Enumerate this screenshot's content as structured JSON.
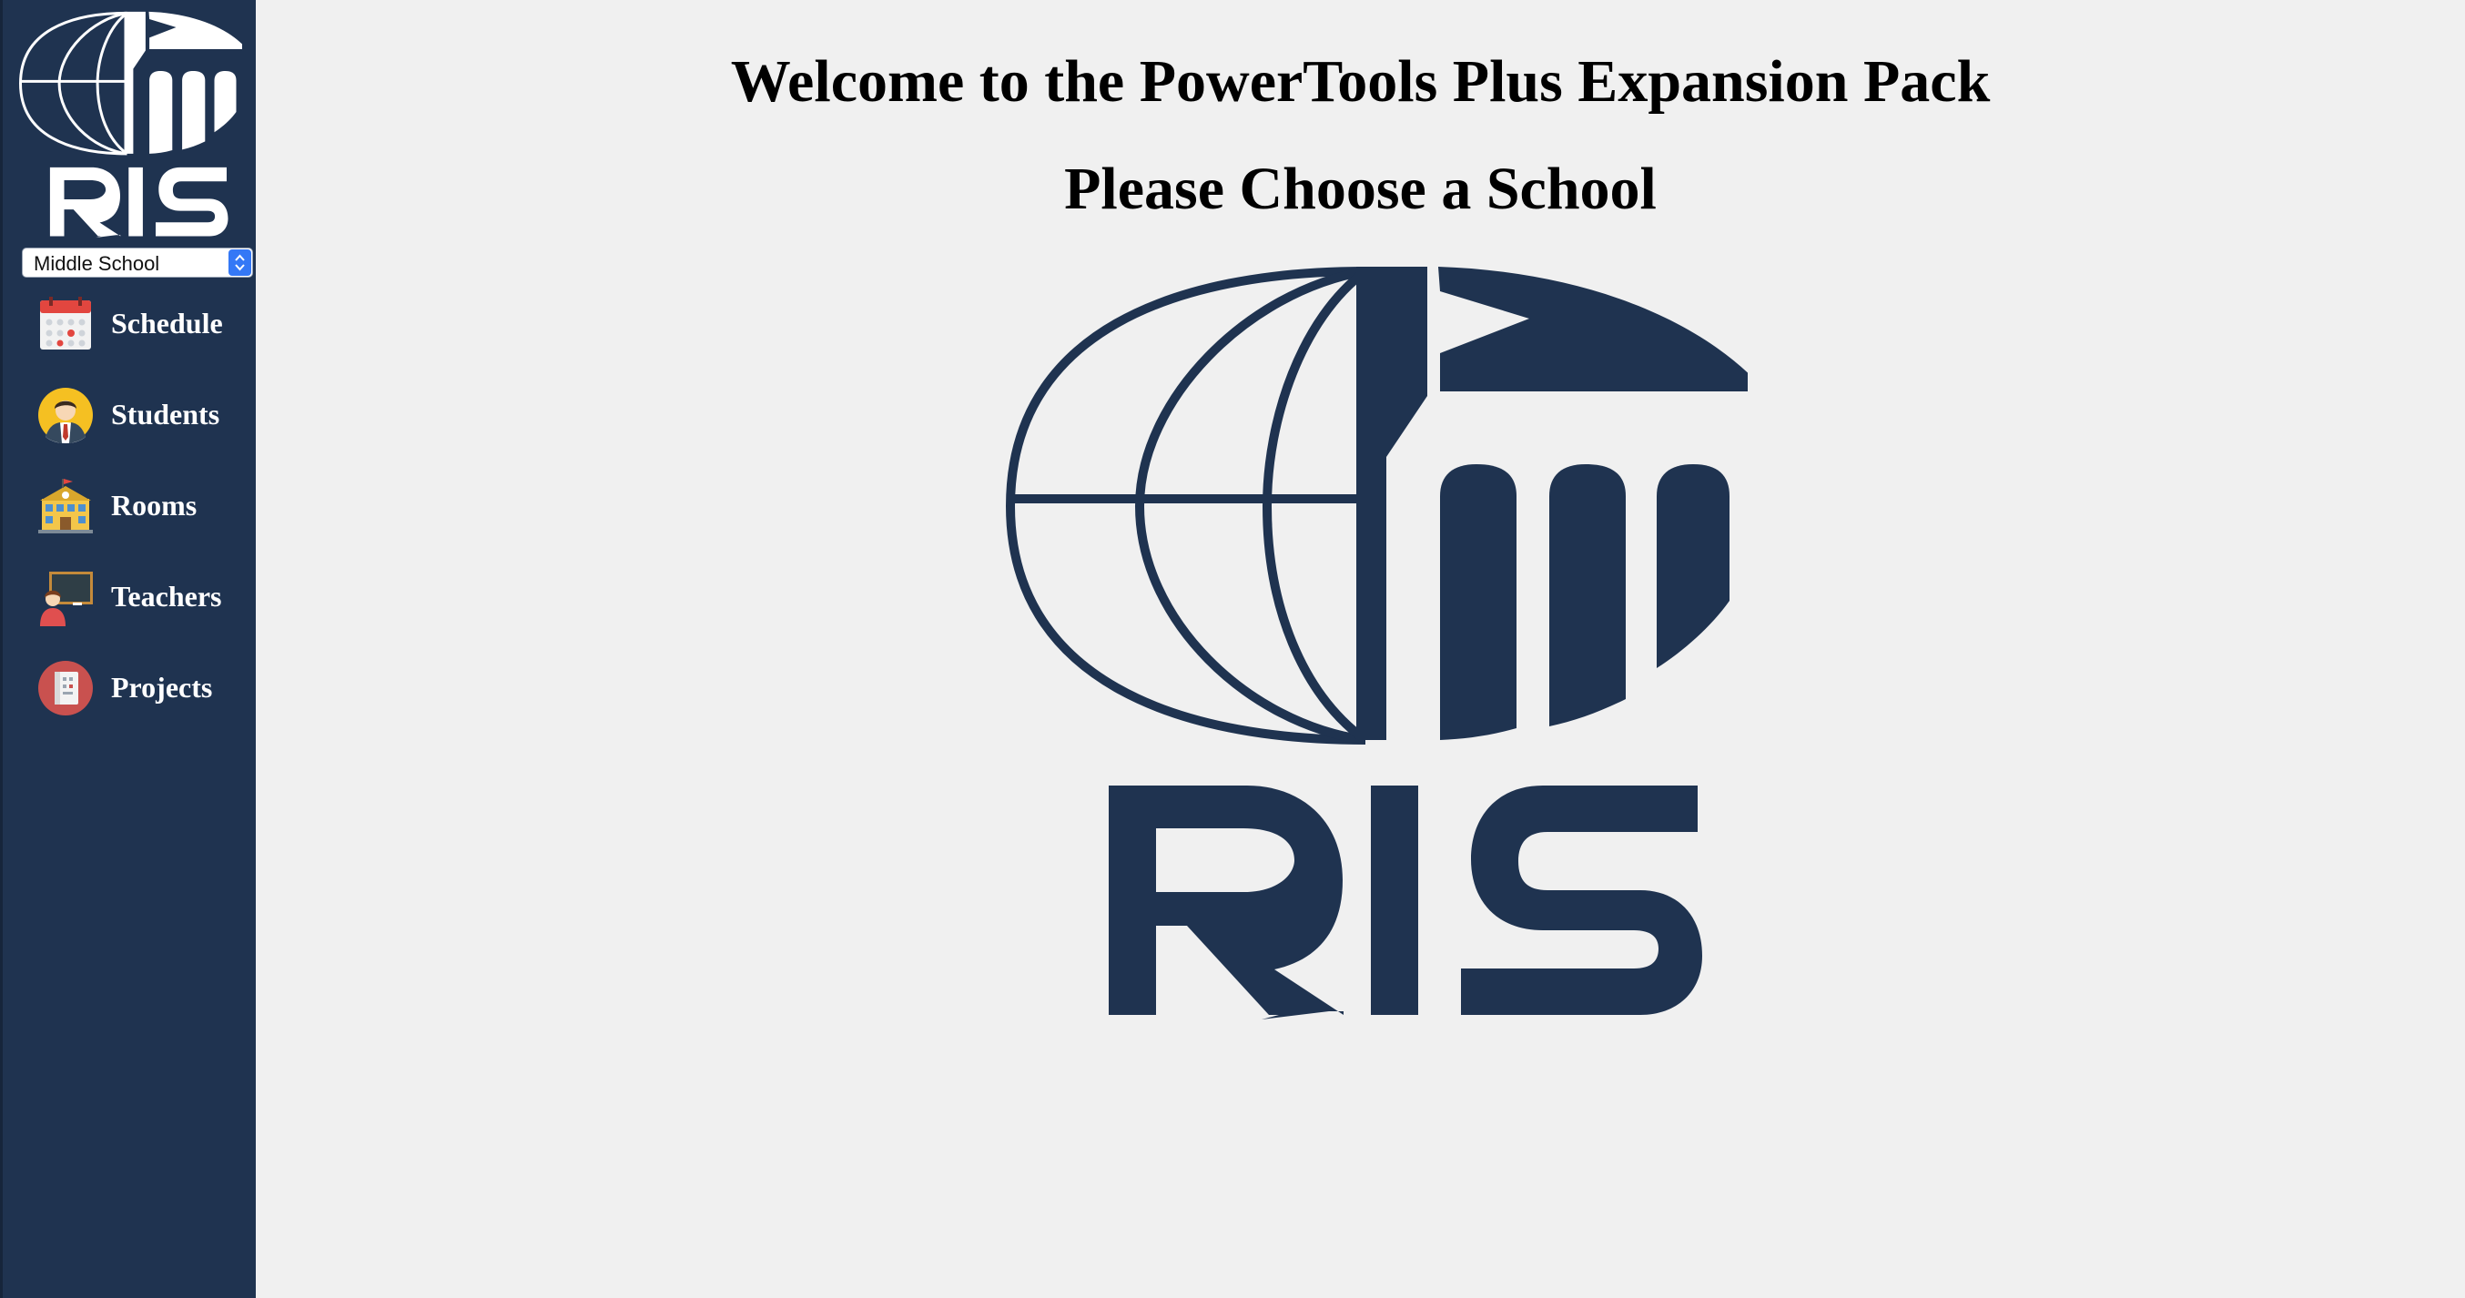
{
  "sidebar": {
    "logo": {
      "text": "RIS",
      "icon": "ris-globe-logo"
    },
    "school_select": {
      "value": "Middle School"
    },
    "items": [
      {
        "label": "Schedule",
        "icon": "calendar-icon"
      },
      {
        "label": "Students",
        "icon": "student-icon"
      },
      {
        "label": "Rooms",
        "icon": "school-building-icon"
      },
      {
        "label": "Teachers",
        "icon": "teacher-chalkboard-icon"
      },
      {
        "label": "Projects",
        "icon": "notebook-icon"
      }
    ]
  },
  "main": {
    "title": "Welcome to the PowerTools Plus Expansion Pack",
    "subtitle": "Please Choose a School",
    "logo": {
      "text": "RIS",
      "icon": "ris-globe-logo"
    }
  },
  "colors": {
    "sidebar_bg": "#1f3350",
    "brand_navy": "#1f3350",
    "page_bg": "#f0f0f0",
    "select_arrow_blue": "#3478f6"
  }
}
